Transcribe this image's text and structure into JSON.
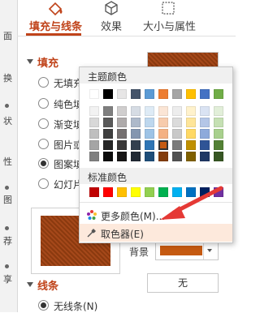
{
  "left_strip": {
    "chars": [
      "面",
      "换",
      "状",
      "性",
      "图",
      "荐",
      "享"
    ]
  },
  "tabs": [
    {
      "label": "填充与线条",
      "icon": "paint-bucket-icon",
      "active": true
    },
    {
      "label": "效果",
      "icon": "cube-icon",
      "active": false
    },
    {
      "label": "大小与属性",
      "icon": "size-box-icon",
      "active": false
    }
  ],
  "fill": {
    "title": "填充",
    "options": [
      {
        "label": "无填充",
        "checked": false
      },
      {
        "label": "纯色填充",
        "checked": false
      },
      {
        "label": "渐变填充",
        "checked": false
      },
      {
        "label": "图片或",
        "checked": false
      },
      {
        "label": "图案填",
        "checked": true
      },
      {
        "label": "幻灯片",
        "checked": false
      }
    ],
    "background_label": "背景"
  },
  "line": {
    "title": "线条",
    "value": "无",
    "options": [
      {
        "label": "无线条(N)",
        "checked": true
      }
    ]
  },
  "popup": {
    "theme_title": "主题颜色",
    "standard_title": "标准颜色",
    "more_colors": "更多颜色(M)...",
    "eyedropper": "取色器(E)",
    "theme_top": [
      "#ffffff",
      "#000000",
      "#e7e6e6",
      "#44546a",
      "#5b9bd5",
      "#ed7d31",
      "#a5a5a5",
      "#ffc000",
      "#4472c4",
      "#70ad47"
    ],
    "theme_shades": [
      [
        "#f2f2f2",
        "#7f7f7f",
        "#d0cece",
        "#d6dce4",
        "#deebf6",
        "#fbe5d5",
        "#ededed",
        "#fff2cc",
        "#dae3f3",
        "#e2efd9"
      ],
      [
        "#d8d8d8",
        "#595959",
        "#aeaaaa",
        "#adb9ca",
        "#bdd7ee",
        "#f7cbac",
        "#dbdbdb",
        "#fee599",
        "#b4c6e7",
        "#c5e0b3"
      ],
      [
        "#bfbfbf",
        "#3f3f3f",
        "#757070",
        "#8496b0",
        "#9dc3e6",
        "#f4b183",
        "#c9c9c9",
        "#ffd965",
        "#8eaadb",
        "#a8d08d"
      ],
      [
        "#a5a5a5",
        "#262626",
        "#3a3838",
        "#323f4f",
        "#2e75b5",
        "#c55a11",
        "#7b7b7b",
        "#bf9000",
        "#2f5496",
        "#538135"
      ],
      [
        "#7f7f7f",
        "#0c0c0c",
        "#171616",
        "#222a35",
        "#1e4e79",
        "#833c0b",
        "#525252",
        "#7f6000",
        "#1f3864",
        "#375623"
      ]
    ],
    "standard_colors": [
      "#c00000",
      "#ff0000",
      "#ffc000",
      "#ffff00",
      "#92d050",
      "#00b050",
      "#00b0f0",
      "#0070c0",
      "#002060",
      "#7030a0"
    ],
    "selected_color": "#c55a11"
  },
  "colors": {
    "accent": "#c0431a",
    "arrow": "#e53935"
  }
}
